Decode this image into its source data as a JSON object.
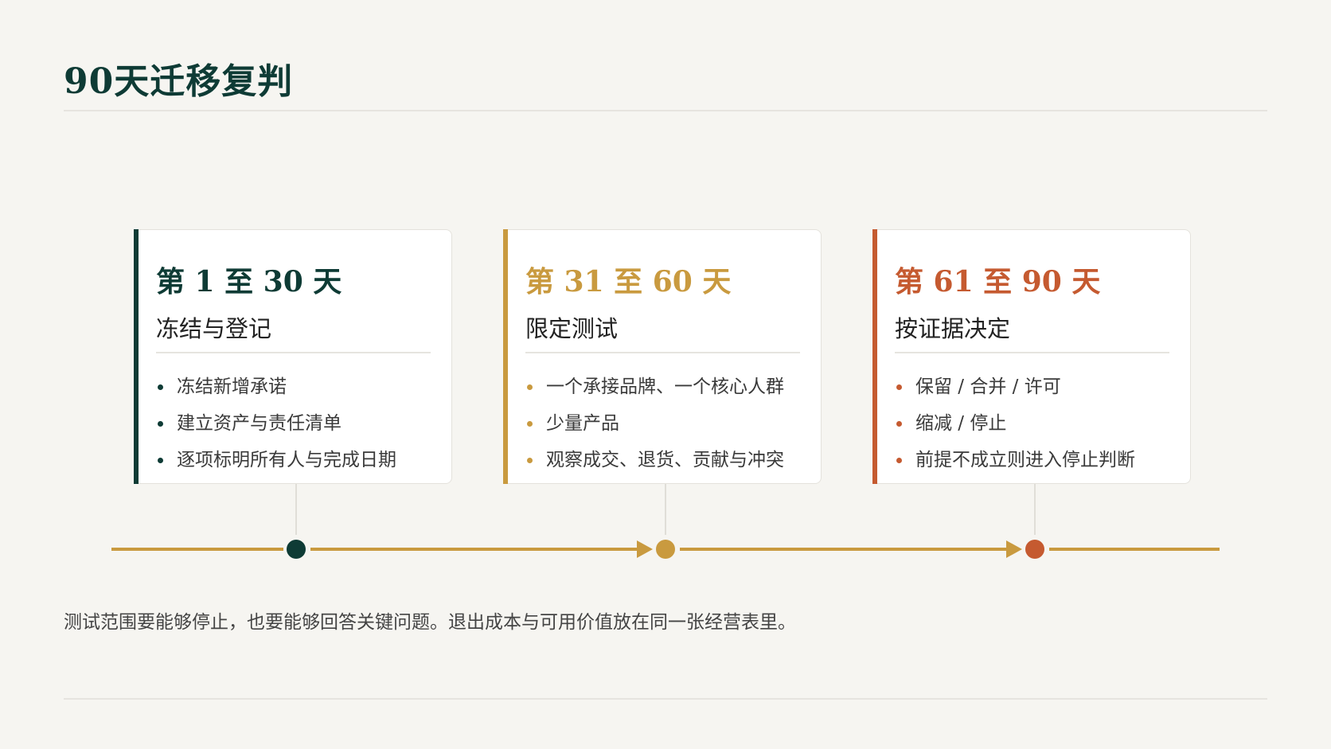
{
  "title": "90天迁移复判",
  "phases": [
    {
      "heading": "第 1 至 30 天",
      "subtitle": "冻结与登记",
      "items": [
        "冻结新增承诺",
        "建立资产与责任清单",
        "逐项标明所有人与完成日期"
      ]
    },
    {
      "heading": "第 31 至 60 天",
      "subtitle": "限定测试",
      "items": [
        "一个承接品牌、一个核心人群",
        "少量产品",
        "观察成交、退货、贡献与冲突"
      ]
    },
    {
      "heading": "第 61 至 90 天",
      "subtitle": "按证据决定",
      "items": [
        "保留 / 合并 / 许可",
        "缩减 / 停止",
        "前提不成立则进入停止判断"
      ]
    }
  ],
  "note": "测试范围要能够停止，也要能够回答关键问题。退出成本与可用价值放在同一张经营表里。",
  "colors": {
    "dark_green": "#0e3b35",
    "gold": "#c99a3f",
    "rust": "#c55a30",
    "background": "#f6f5f1"
  }
}
